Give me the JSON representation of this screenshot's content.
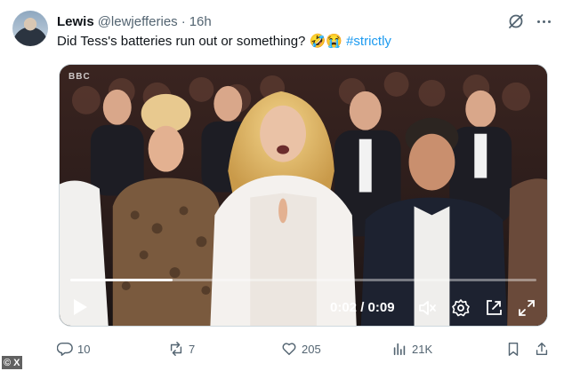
{
  "author": {
    "name": "Lewis",
    "handle": "@lewjefferies",
    "separator": "·",
    "time": "16h"
  },
  "tweet": {
    "text": "Did Tess's batteries run out or something? 🤣😭",
    "hashtag": "#strictly"
  },
  "media": {
    "channel_logo": "BBC",
    "time_display": "0:02 / 0:09",
    "progress": 0.22,
    "icons": [
      "play-icon",
      "mute-icon",
      "settings-icon",
      "popout-icon",
      "fullscreen-icon"
    ]
  },
  "actions": {
    "replies": "10",
    "reposts": "7",
    "likes": "205",
    "views": "21K"
  },
  "watermark": "© X",
  "colors": {
    "text": "#0f1419",
    "secondary": "#536471",
    "link": "#1d9bf0",
    "border": "#cfd9de"
  }
}
